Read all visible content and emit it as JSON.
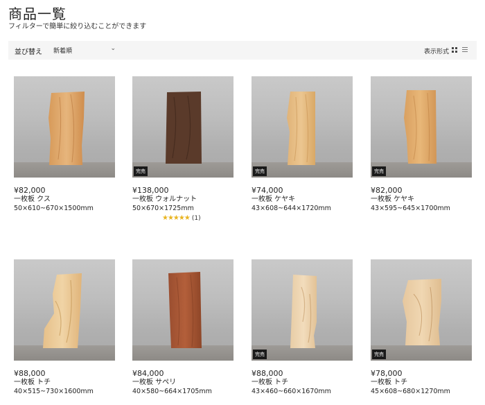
{
  "page": {
    "title": "商品一覧",
    "subtitle": "フィルターで簡単に絞り込むことができます"
  },
  "toolbar": {
    "sort_label": "並び替え",
    "sort_value": "新着順",
    "view_label": "表示形式"
  },
  "products": [
    {
      "price": "¥82,000",
      "name": "一枚板 クス",
      "size": "50×610~670×1500mm",
      "sold_out": ""
    },
    {
      "price": "¥138,000",
      "name": "一枚板 ウォルナット",
      "size": "50×670×1725mm",
      "sold_out": "完売",
      "rating_count": "(1)"
    },
    {
      "price": "¥74,000",
      "name": "一枚板 ケヤキ",
      "size": "43×608~644×1720mm",
      "sold_out": "完売"
    },
    {
      "price": "¥82,000",
      "name": "一枚板 ケヤキ",
      "size": "43×595~645×1700mm",
      "sold_out": "完売"
    },
    {
      "price": "¥88,000",
      "name": "一枚板 トチ",
      "size": "40×515~730×1600mm",
      "sold_out": ""
    },
    {
      "price": "¥84,000",
      "name": "一枚板 サペリ",
      "size": "40×580~664×1705mm",
      "sold_out": ""
    },
    {
      "price": "¥88,000",
      "name": "一枚板 トチ",
      "size": "43×460~660×1670mm",
      "sold_out": "完売"
    },
    {
      "price": "¥78,000",
      "name": "一枚板 トチ",
      "size": "45×608~680×1270mm",
      "sold_out": "完売"
    }
  ],
  "colors": {
    "rating_star": "#e9b420",
    "badge_bg": "#1a1a1a",
    "toolbar_bg": "#f5f5f5"
  },
  "icons": {
    "sort_chevron": "chevron-down-icon",
    "view_grid": "grid-view-icon",
    "view_list": "list-view-icon",
    "rating": "star-icon"
  }
}
